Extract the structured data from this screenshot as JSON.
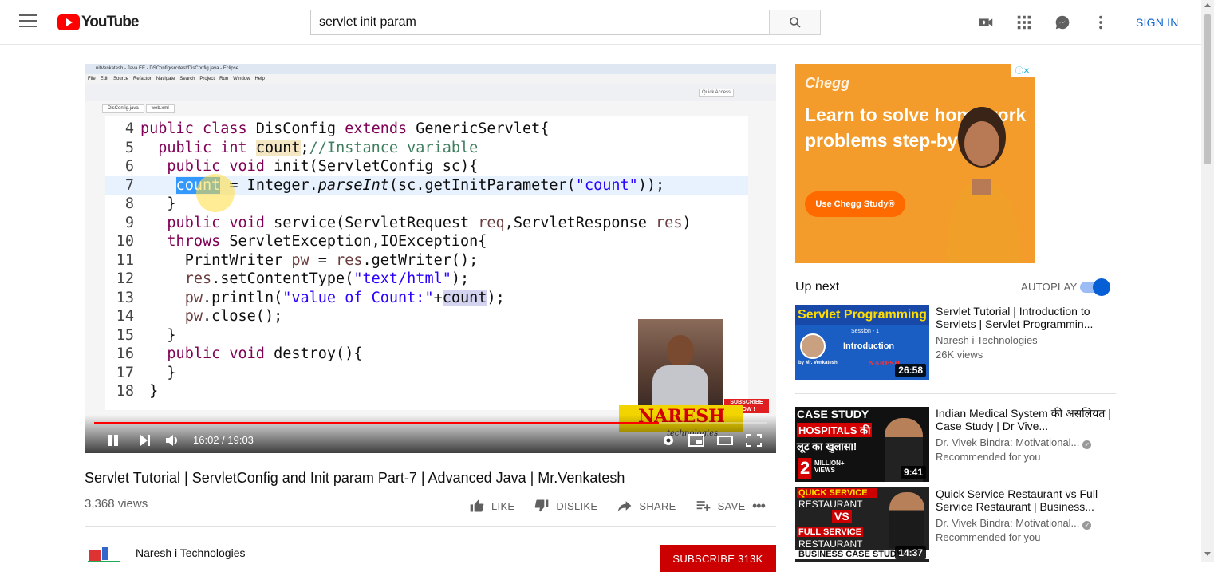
{
  "header": {
    "logo_text": "YouTube",
    "search_value": "servlet init param",
    "signin_label": "SIGN IN"
  },
  "video": {
    "ide_window_title": "nitVenkatesh - Java EE - DSConfig/src/test/DisConfig.java - Eclipse",
    "ide_menu": [
      "File",
      "Edit",
      "Source",
      "Refactor",
      "Navigate",
      "Search",
      "Project",
      "Run",
      "Window",
      "Help"
    ],
    "ide_tabs": [
      "DisConfig.java",
      "web.xml"
    ],
    "quick_access": "Quick Access",
    "code_lines": [
      {
        "num": "4",
        "html": "<span class=\"kw\">public class</span> DisConfig <span class=\"kw\">extends</span> GenericServlet{"
      },
      {
        "num": "5",
        "html": "  <span class=\"kw\">public int</span> <span class=\"var\" style=\"background:#f5e6c4\">count</span>;<span class=\"cm\">//Instance variable</span>"
      },
      {
        "num": "6",
        "html": "   <span class=\"kw\">public void</span> init(ServletConfig sc){"
      },
      {
        "num": "7",
        "html": "    <span class=\"var\" style=\"background:#3399ff;color:#fff\">count</span> = Integer.<span class=\"it\">parseInt</span>(sc.getInitParameter(<span class=\"str\">\"count\"</span>));"
      },
      {
        "num": "8",
        "html": "   }"
      },
      {
        "num": "9",
        "html": "   <span class=\"kw\">public void</span> service(ServletRequest <span style=\"color:#6a3e3e\">req</span>,ServletResponse <span style=\"color:#6a3e3e\">res</span>)"
      },
      {
        "num": "10",
        "html": "   <span class=\"kw\">throws</span> ServletException,IOException{"
      },
      {
        "num": "11",
        "html": "     PrintWriter <span style=\"color:#6a3e3e\">pw</span> = <span style=\"color:#6a3e3e\">res</span>.getWriter();"
      },
      {
        "num": "12",
        "html": "     <span style=\"color:#6a3e3e\">res</span>.setContentType(<span class=\"str\">\"text/html\"</span>);"
      },
      {
        "num": "13",
        "html": "     <span style=\"color:#6a3e3e\">pw</span>.println(<span class=\"str\">\"value of Count:\"</span>+<span class=\"var\">count</span>);"
      },
      {
        "num": "14",
        "html": "     <span style=\"color:#6a3e3e\">pw</span>.close();"
      },
      {
        "num": "15",
        "html": "   }"
      },
      {
        "num": "16",
        "html": "   <span class=\"kw\">public void</span> destroy(){"
      },
      {
        "num": "17",
        "html": "   }"
      },
      {
        "num": "18",
        "html": " }"
      }
    ],
    "brand_text": "NARESH",
    "brand_sub": "technologies",
    "subscribe_badge": "SUBSCRIBE NOW !",
    "time_display": "16:02 / 19:03",
    "progress": 0.84,
    "title": "Servlet Tutorial | ServletConfig and Init param Part-7 | Advanced Java | Mr.Venkatesh",
    "views": "3,368 views",
    "actions": {
      "like": "LIKE",
      "dislike": "DISLIKE",
      "share": "SHARE",
      "save": "SAVE"
    },
    "channel_name": "Naresh i Technologies",
    "subscribe_label": "SUBSCRIBE  313K"
  },
  "ad": {
    "brand": "Chegg",
    "text": "Learn to solve homework problems step-by-step",
    "cta": "Use Chegg Study®"
  },
  "sidebar": {
    "up_next_label": "Up next",
    "autoplay_label": "AUTOPLAY",
    "autoplay_on": true,
    "recommendations": [
      {
        "title": "Servlet Tutorial | Introduction to Servlets | Servlet Programmin...",
        "channel": "Naresh i Technologies",
        "meta": "26K views",
        "duration": "26:58",
        "thumb_title": "Servlet Programming",
        "thumb_session": "Session - 1",
        "thumb_sub": "Introduction",
        "thumb_by": "by Mr. Venkatesh",
        "thumb_brand": "NARESH"
      },
      {
        "title": "Indian Medical System की असलियत | Case Study | Dr Vive...",
        "channel": "Dr. Vivek Bindra: Motivational...",
        "meta": "Recommended for you",
        "duration": "9:41",
        "thumb_line1": "CASE STUDY",
        "thumb_line2": "HOSPITALS की",
        "thumb_line3": "लूट का खुलासा!",
        "thumb_line4": "2",
        "thumb_line5": "MILLION+ VIEWS"
      },
      {
        "title": "Quick Service Restaurant vs Full Service Restaurant | Business...",
        "channel": "Dr. Vivek Bindra: Motivational...",
        "meta": "Recommended for you",
        "duration": "14:37",
        "thumb_line1": "QUICK SERVICE",
        "thumb_line2": "RESTAURANT",
        "thumb_line3": "VS",
        "thumb_line4": "FULL SERVICE",
        "thumb_line5": "RESTAURANT",
        "thumb_line6": "BUSINESS CASE STUDY"
      }
    ]
  },
  "colors": {
    "brand_red": "#ff0000",
    "link_blue": "#065fd4",
    "subscribe_red": "#cc0000",
    "ad_orange": "#f39c2b"
  }
}
